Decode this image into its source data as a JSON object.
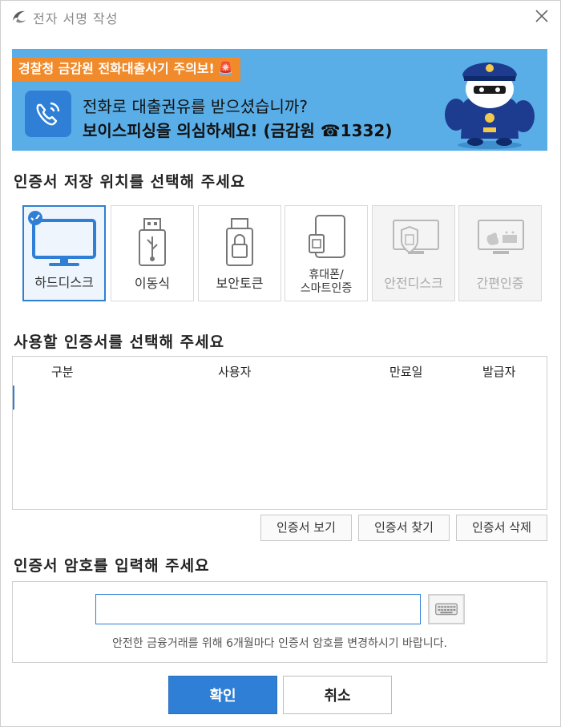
{
  "window": {
    "title": "전자 서명 작성",
    "logo_icon": "dolphin-logo-icon",
    "close_icon": "close-icon"
  },
  "banner": {
    "warning": "경찰청 금감원 전화대출사기 주의보!",
    "line1": "전화로 대출권유를 받으셨습니까?",
    "line2": "보이스피싱을 의심하세요! (금감원 ☎1332)",
    "phone_icon": "phone-ringing-icon",
    "mascot": "police-mascot",
    "colors": {
      "background": "#5aaee8",
      "warning_bg": "#f08a2a",
      "phone_box": "#2f7fd6"
    }
  },
  "storage": {
    "heading": "인증서 저장 위치를 선택해 주세요",
    "options": [
      {
        "label": "하드디스크",
        "icon": "monitor-icon",
        "selected": true,
        "disabled": false
      },
      {
        "label": "이동식",
        "icon": "usb-drive-icon",
        "selected": false,
        "disabled": false
      },
      {
        "label": "보안토큰",
        "icon": "security-token-icon",
        "selected": false,
        "disabled": false
      },
      {
        "label": "휴대폰/\n스마트인증",
        "label_line1": "휴대폰/",
        "label_line2": "스마트인증",
        "icon": "mobile-phone-icon",
        "selected": false,
        "disabled": false
      },
      {
        "label": "안전디스크",
        "icon": "secure-disk-icon",
        "selected": false,
        "disabled": true
      },
      {
        "label": "간편인증",
        "icon": "simple-auth-icon",
        "selected": false,
        "disabled": true
      }
    ]
  },
  "certificates": {
    "heading": "사용할 인증서를 선택해 주세요",
    "columns": [
      "구분",
      "사용자",
      "만료일",
      "발급자"
    ],
    "rows": []
  },
  "cert_buttons": {
    "view": "인증서 보기",
    "find": "인증서 찾기",
    "delete": "인증서 삭제"
  },
  "password": {
    "heading": "인증서 암호를 입력해 주세요",
    "value": "",
    "placeholder": "",
    "keyboard_icon": "keyboard-icon",
    "note": "안전한 금융거래를 위해 6개월마다 인증서 암호를 변경하시기 바랍니다."
  },
  "actions": {
    "confirm": "확인",
    "cancel": "취소"
  },
  "colors": {
    "accent": "#2f7fd6",
    "border": "#cfcfcf"
  }
}
